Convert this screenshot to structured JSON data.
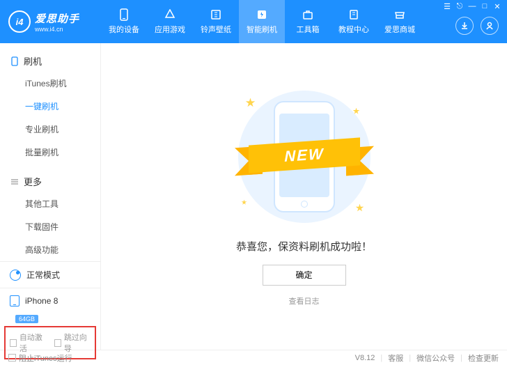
{
  "app": {
    "logo_text": "i4",
    "name": "爱思助手",
    "url": "www.i4.cn"
  },
  "nav": [
    {
      "label": "我的设备",
      "icon": "phone"
    },
    {
      "label": "应用游戏",
      "icon": "apps"
    },
    {
      "label": "铃声壁纸",
      "icon": "music"
    },
    {
      "label": "智能刷机",
      "icon": "flash",
      "active": true
    },
    {
      "label": "工具箱",
      "icon": "toolbox"
    },
    {
      "label": "教程中心",
      "icon": "book"
    },
    {
      "label": "爱思商城",
      "icon": "shop"
    }
  ],
  "sidebar": {
    "groups": [
      {
        "title": "刷机",
        "items": [
          {
            "label": "iTunes刷机"
          },
          {
            "label": "一键刷机",
            "selected": true
          },
          {
            "label": "专业刷机"
          },
          {
            "label": "批量刷机"
          }
        ]
      },
      {
        "title": "更多",
        "items": [
          {
            "label": "其他工具"
          },
          {
            "label": "下载固件"
          },
          {
            "label": "高级功能"
          }
        ]
      }
    ],
    "mode": "正常模式",
    "device": "iPhone 8",
    "storage": "64GB",
    "auto_activate": "自动激活",
    "skip_guide": "跳过向导"
  },
  "main": {
    "banner": "NEW",
    "message": "恭喜您，保资料刷机成功啦！",
    "ok": "确定",
    "view_log": "查看日志"
  },
  "footer": {
    "block_itunes": "阻止iTunes运行",
    "version": "V8.12",
    "support": "客服",
    "wechat": "微信公众号",
    "update": "检查更新"
  }
}
